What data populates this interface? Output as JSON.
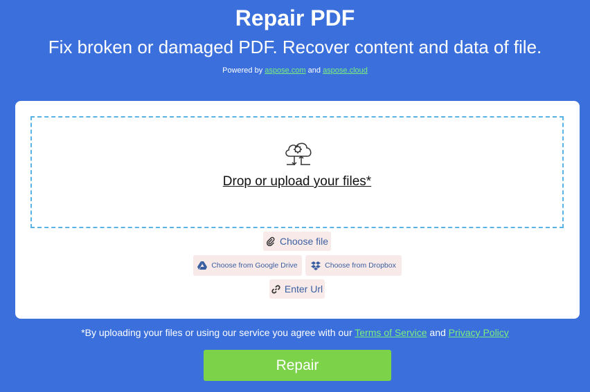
{
  "header": {
    "title": "Repair PDF",
    "subtitle": "Fix broken or damaged PDF. Recover content and data of file.",
    "powered_prefix": "Powered by",
    "powered_link1": "aspose.com",
    "powered_and": "and",
    "powered_link2": "aspose.cloud"
  },
  "upload": {
    "drop_text": "Drop or upload your files*",
    "choose_file": "Choose file",
    "google_drive": "Choose from Google Drive",
    "dropbox": "Choose from Dropbox",
    "enter_url": "Enter Url"
  },
  "terms": {
    "prefix": "*By uploading your files or using our service you agree with our",
    "tos": "Terms of Service",
    "and": "and",
    "privacy": "Privacy Policy"
  },
  "action": {
    "repair_label": "Repair"
  },
  "icons": {
    "upload": "cloud-upload-icon",
    "choose_file": "paperclip-icon",
    "google_drive": "google-drive-icon",
    "dropbox": "dropbox-icon",
    "enter_url": "link-icon"
  },
  "colors": {
    "background": "#3a6fdc",
    "link": "#7cf07c",
    "accent": "#7cd34a",
    "button_bg": "#f9eaea",
    "dropzone_border": "#5ab3e6"
  }
}
